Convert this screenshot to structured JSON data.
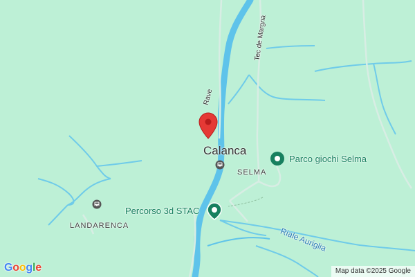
{
  "map": {
    "place": "Calanca",
    "hamlets": {
      "selma": "SELMA",
      "landarenca": "LANDARENCA"
    },
    "pois": {
      "playground": "Parco giochi Selma",
      "trail": "Percorso 3d STAC"
    },
    "roads": {
      "tec_de_margna": "Tec de Margna",
      "rave": "Rave"
    },
    "waterways": {
      "riale_auriglia": "Riale Auriglia"
    },
    "attribution": "Map data ©2025 Google",
    "logo": "Google",
    "colors": {
      "land": "#bdf0d6",
      "river": "#5ec3ea",
      "poi": "#17805f",
      "pin": "#e53935"
    },
    "icons": [
      "location-pin-icon",
      "bus-stop-icon",
      "poi-marker-icon"
    ]
  }
}
